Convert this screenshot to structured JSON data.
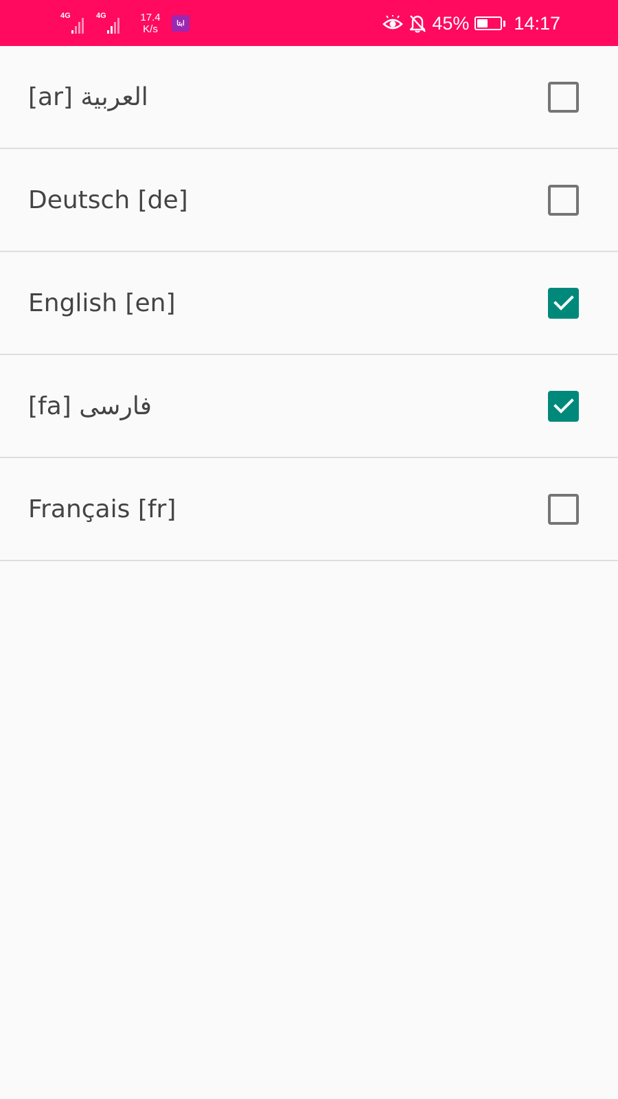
{
  "colors": {
    "status_bar": "#ff0a5f",
    "checkbox_checked": "#00897b",
    "checkbox_unchecked": "#757575",
    "background": "#fafafa",
    "divider": "#dedede",
    "app_badge": "#9c27b0"
  },
  "status_bar": {
    "network_1": "4G",
    "network_2": "4G",
    "speed_value": "17.4",
    "speed_unit": "K/s",
    "app_badge_text": "ابتا",
    "battery_percent": "45%",
    "battery_level": 0.45,
    "time": "14:17",
    "icons": [
      "eye-icon",
      "bell-off-icon",
      "battery-icon",
      "signal-icon"
    ]
  },
  "languages": [
    {
      "label": "العربية [ar]",
      "checked": false
    },
    {
      "label": "Deutsch [de]",
      "checked": false
    },
    {
      "label": "English [en]",
      "checked": true
    },
    {
      "label": "فارسی [fa]",
      "checked": true
    },
    {
      "label": "Français [fr]",
      "checked": false
    }
  ]
}
